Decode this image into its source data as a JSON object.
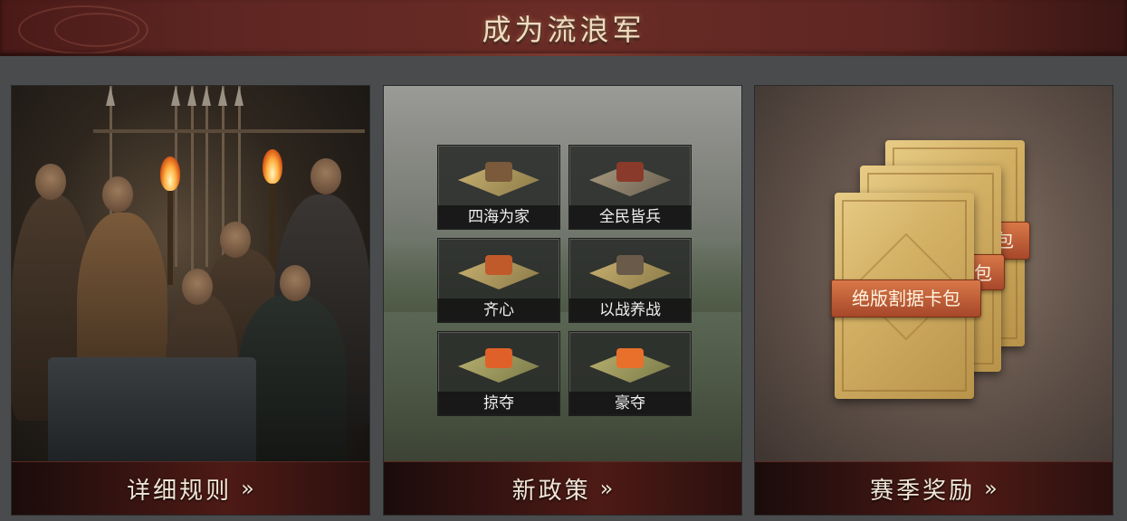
{
  "header": {
    "title": "成为流浪军"
  },
  "panels": [
    {
      "footer_label": "详细规则",
      "footer_icon": "double-chevron-right-icon",
      "chevron": "»"
    },
    {
      "footer_label": "新政策",
      "footer_icon": "double-chevron-right-icon",
      "chevron": "»",
      "policies": [
        {
          "label": "四海为家"
        },
        {
          "label": "全民皆兵"
        },
        {
          "label": "齐心"
        },
        {
          "label": "以战养战"
        },
        {
          "label": "掠夺"
        },
        {
          "label": "豪夺"
        }
      ]
    },
    {
      "footer_label": "赛季奖励",
      "footer_icon": "double-chevron-right-icon",
      "chevron": "»",
      "card_labels": {
        "front": "绝版割据卡包",
        "middle_partial": "包",
        "back_partial": "包"
      }
    }
  ],
  "colors": {
    "banner": "#5e2622",
    "footer": "#3c1512",
    "card_gold": "#d2b064",
    "card_tag": "#c0603a"
  }
}
